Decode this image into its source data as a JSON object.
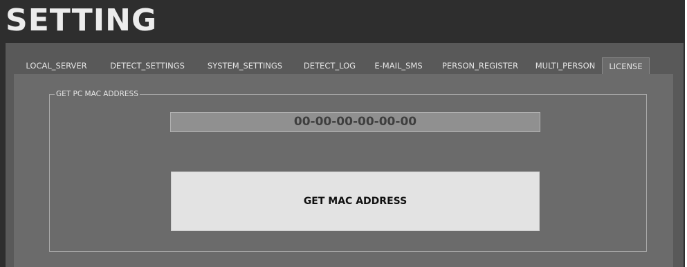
{
  "app": {
    "title": "SETTING"
  },
  "tabs": [
    {
      "label": "LOCAL_SERVER"
    },
    {
      "label": "DETECT_SETTINGS"
    },
    {
      "label": "SYSTEM_SETTINGS"
    },
    {
      "label": "DETECT_LOG"
    },
    {
      "label": "E-MAIL_SMS"
    },
    {
      "label": "PERSON_REGISTER"
    },
    {
      "label": "MULTI_PERSON"
    },
    {
      "label": "LICENSE",
      "active": true
    }
  ],
  "license": {
    "group_title": "GET PC MAC ADDRESS",
    "mac_address": "00-00-00-00-00-00",
    "button_label": "GET MAC ADDRESS"
  },
  "colors": {
    "window_bg": "#2e2e2e",
    "tab_area_bg": "#595959",
    "panel_bg": "#6b6b6b",
    "display_bg": "#909090",
    "button_bg": "#e3e3e3"
  }
}
